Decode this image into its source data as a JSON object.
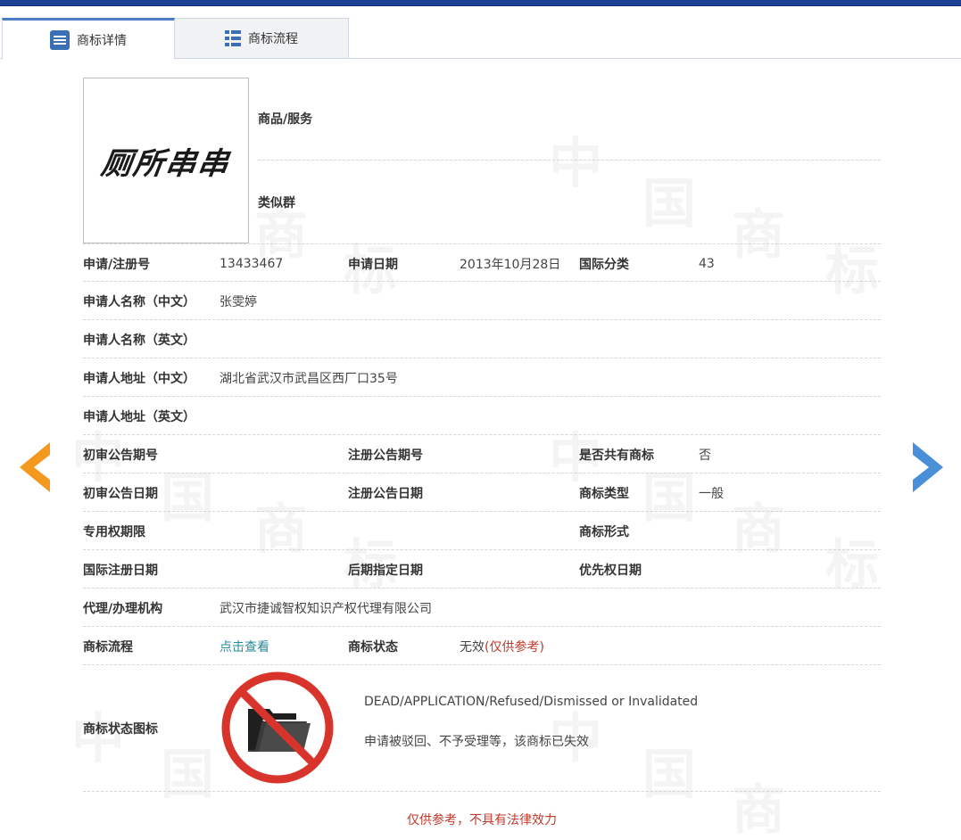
{
  "tabs": [
    {
      "label": "商标详情",
      "icon": "document-list-icon",
      "active": true
    },
    {
      "label": "商标流程",
      "icon": "list-flow-icon",
      "active": false
    }
  ],
  "mark": {
    "image_text": "厕所串串"
  },
  "goods": {
    "goods_label": "商品/服务",
    "group_label": "类似群"
  },
  "fields": {
    "reg_no_label": "申请/注册号",
    "reg_no": "13433467",
    "app_date_label": "申请日期",
    "app_date": "2013年10月28日",
    "intl_class_label": "国际分类",
    "intl_class": "43",
    "applicant_cn_label": "申请人名称（中文）",
    "applicant_cn": "张雯婷",
    "applicant_en_label": "申请人名称（英文）",
    "address_cn_label": "申请人地址（中文）",
    "address_cn": "湖北省武汉市武昌区西厂口35号",
    "address_en_label": "申请人地址（英文）",
    "prelim_pub_no_label": "初审公告期号",
    "reg_pub_no_label": "注册公告期号",
    "shared_label": "是否共有商标",
    "shared": "否",
    "prelim_pub_date_label": "初审公告日期",
    "reg_pub_date_label": "注册公告日期",
    "mark_type_label": "商标类型",
    "mark_type": "一般",
    "exclusive_term_label": "专用权期限",
    "mark_form_label": "商标形式",
    "intl_reg_date_label": "国际注册日期",
    "later_designation_label": "后期指定日期",
    "priority_date_label": "优先权日期",
    "agent_label": "代理/办理机构",
    "agent": "武汉市捷诚智权知识产权代理有限公司",
    "process_label": "商标流程",
    "process_link": "点击查看",
    "status_label": "商标状态",
    "status": "无效",
    "status_note": "(仅供参考)",
    "status_icon_label": "商标状态图标",
    "status_en": "DEAD/APPLICATION/Refused/Dismissed or Invalidated",
    "status_cn": "申请被驳回、不予受理等，该商标已失效"
  },
  "disclaimer": "仅供参考，不具有法律效力",
  "colors": {
    "topbar": "#1d3f94",
    "arrow_left": "#f39a1e",
    "arrow_right": "#4a90d9",
    "link": "#2a8a9a",
    "warning_red": "#c0392b",
    "prohibited_red": "#d9342b"
  }
}
